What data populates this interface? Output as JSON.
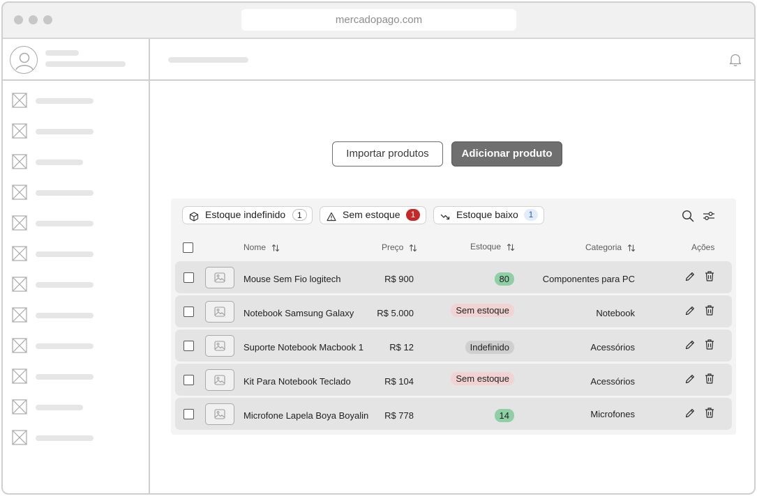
{
  "browser": {
    "url": "mercadopago.com"
  },
  "actions": {
    "import_label": "Importar produtos",
    "add_label": "Adicionar produto"
  },
  "filters": [
    {
      "label": "Estoque indefinido",
      "count": "1",
      "icon": "box-icon",
      "count_bg": "#ffffff",
      "count_color": "#1f1f1f"
    },
    {
      "label": "Sem estoque",
      "count": "1",
      "icon": "warning-icon",
      "count_bg": "#c62828",
      "count_color": "#ffffff"
    },
    {
      "label": "Estoque baixo",
      "count": "1",
      "icon": "trend-down-icon",
      "count_bg": "#e3ecfb",
      "count_color": "#2f5fb5"
    }
  ],
  "table": {
    "headers": {
      "name": "Nome",
      "price": "Preço",
      "stock": "Estoque",
      "category": "Categoria",
      "actions": "Ações"
    },
    "rows": [
      {
        "name": "Mouse Sem Fio logitech",
        "price": "R$ 900",
        "stock": "80",
        "stock_type": "number",
        "category": "Componentes para PC"
      },
      {
        "name": "Notebook Samsung Galaxy",
        "price": "R$ 5.000",
        "stock": "Sem estoque",
        "stock_type": "out",
        "category": "Notebook"
      },
      {
        "name": "Suporte Notebook Macbook 1",
        "price": "R$ 12",
        "stock": "Indefinido",
        "stock_type": "undefined",
        "category": "Acessórios"
      },
      {
        "name": "Kit Para Notebook Teclado",
        "price": "R$ 104",
        "stock": "Sem estoque",
        "stock_type": "out",
        "category": "Acessórios"
      },
      {
        "name": "Microfone Lapela Boya Boyalin",
        "price": "R$ 778",
        "stock": "14",
        "stock_type": "number",
        "category": "Microfones"
      }
    ]
  },
  "colors": {
    "stock_number_bg": "#8fcfa5",
    "stock_out_bg": "#f2d3d3",
    "stock_undefined_bg": "#cfcfcf",
    "primary_button": "#6f6f6f"
  }
}
